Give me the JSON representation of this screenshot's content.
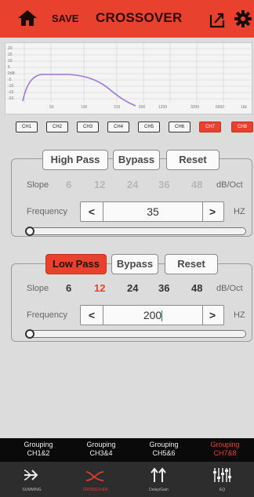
{
  "header": {
    "home_icon": "home-icon",
    "save_label": "SAVE",
    "title": "CROSSOVER",
    "export_icon": "export-icon",
    "settings_icon": "gear-icon"
  },
  "graph": {
    "y_labels": [
      "20",
      "15",
      "10",
      "5",
      "0dB",
      "-5",
      "-10",
      "-15",
      "-20"
    ],
    "x_labels": [
      "50",
      "100",
      "315",
      "500",
      "1200",
      "3200",
      "6600",
      "16k"
    ],
    "curve_color": "#9b78d6"
  },
  "channels": [
    {
      "label": "CH1",
      "active": false
    },
    {
      "label": "CH2",
      "active": false
    },
    {
      "label": "CH3",
      "active": false
    },
    {
      "label": "CH4",
      "active": false
    },
    {
      "label": "CH5",
      "active": false
    },
    {
      "label": "CH6",
      "active": false
    },
    {
      "label": "CH7",
      "active": true
    },
    {
      "label": "CH8",
      "active": true
    }
  ],
  "high_pass": {
    "mode_label": "High Pass",
    "bypass_label": "Bypass",
    "reset_label": "Reset",
    "slope_label": "Slope",
    "slopes": [
      "6",
      "12",
      "24",
      "36",
      "48"
    ],
    "slope_unit": "dB/Oct",
    "freq_label": "Frequency",
    "freq_value": "35",
    "freq_unit": "HZ",
    "down_arrow": "<",
    "up_arrow": ">",
    "slider_position": 0.0
  },
  "low_pass": {
    "mode_label": "Low Pass",
    "bypass_label": "Bypass",
    "reset_label": "Reset",
    "slope_label": "Slope",
    "slopes": [
      "6",
      "12",
      "24",
      "36",
      "48"
    ],
    "selected_slope": "12",
    "slope_unit": "dB/Oct",
    "freq_label": "Frequency",
    "freq_value": "200",
    "freq_unit": "HZ",
    "down_arrow": "<",
    "up_arrow": ">",
    "slider_position": 0.0
  },
  "grouping": [
    {
      "line1": "Grouping",
      "line2": "CH1&2",
      "active": false
    },
    {
      "line1": "Grouping",
      "line2": "CH3&4",
      "active": false
    },
    {
      "line1": "Grouping",
      "line2": "CH5&6",
      "active": false
    },
    {
      "line1": "Grouping",
      "line2": "CH7&8",
      "active": true
    }
  ],
  "bottom_nav": [
    {
      "label": "SUMMING",
      "icon": "summing-icon",
      "active": false
    },
    {
      "label": "CROSSOVER",
      "icon": "crossover-icon",
      "active": true
    },
    {
      "label": "Delay/Gain",
      "icon": "delay-gain-icon",
      "active": false
    },
    {
      "label": "EQ",
      "icon": "eq-icon",
      "active": false
    }
  ],
  "colors": {
    "accent": "#e8412d",
    "background": "#dcdcdc",
    "nav_bg": "#2d2d2d"
  }
}
